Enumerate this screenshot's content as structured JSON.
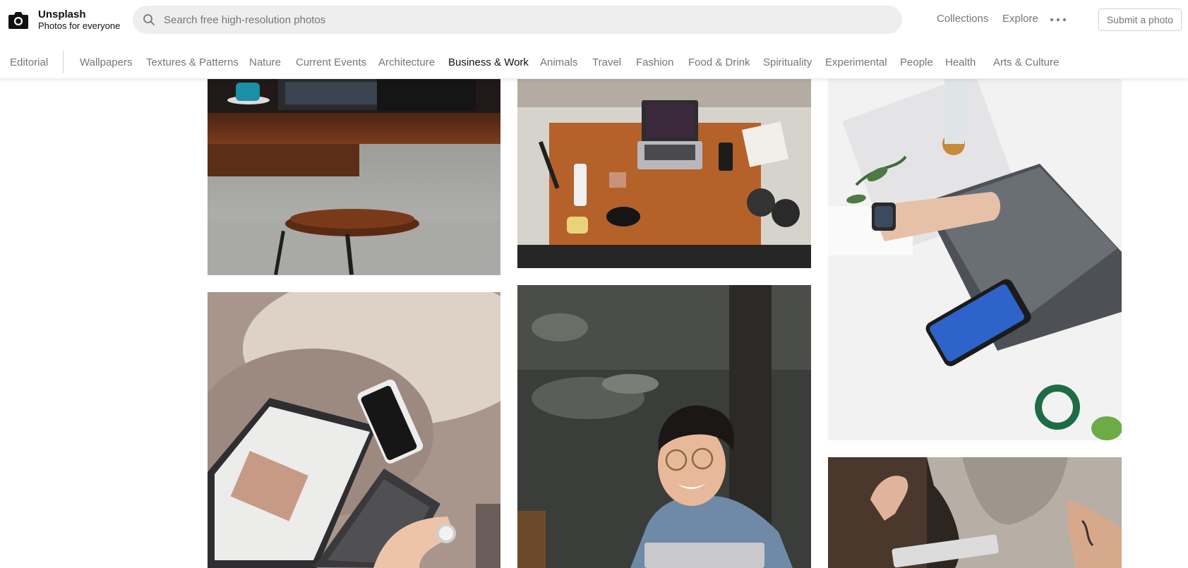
{
  "header": {
    "brand_name": "Unsplash",
    "brand_tagline": "Photos for everyone",
    "search_placeholder": "Search free high-resolution photos",
    "nav": {
      "collections": "Collections",
      "explore": "Explore"
    },
    "submit_label": "Submit a photo",
    "icons": {
      "logo": "camera-icon",
      "search": "search-icon",
      "more": "more-icon"
    }
  },
  "categories": {
    "editorial": "Editorial",
    "items": [
      "Wallpapers",
      "Textures & Patterns",
      "Nature",
      "Current Events",
      "Architecture",
      "Business & Work",
      "Animals",
      "Travel",
      "Fashion",
      "Food & Drink",
      "Spirituality",
      "Experimental",
      "People",
      "Health",
      "Arts & Culture"
    ],
    "active": "Business & Work"
  },
  "photos": [
    "desk with blue mug and wooden stool",
    "overhead desk with laptop and headphones",
    "hand on laptop with smartwatch and phone",
    "laptop on fluffy rug with phone",
    "smiling person with glasses and laptop",
    "person with tattoo using laptop"
  ],
  "colors": {
    "accent_text": "#111111",
    "muted_text": "#767676",
    "search_bg": "#eeeeee"
  }
}
